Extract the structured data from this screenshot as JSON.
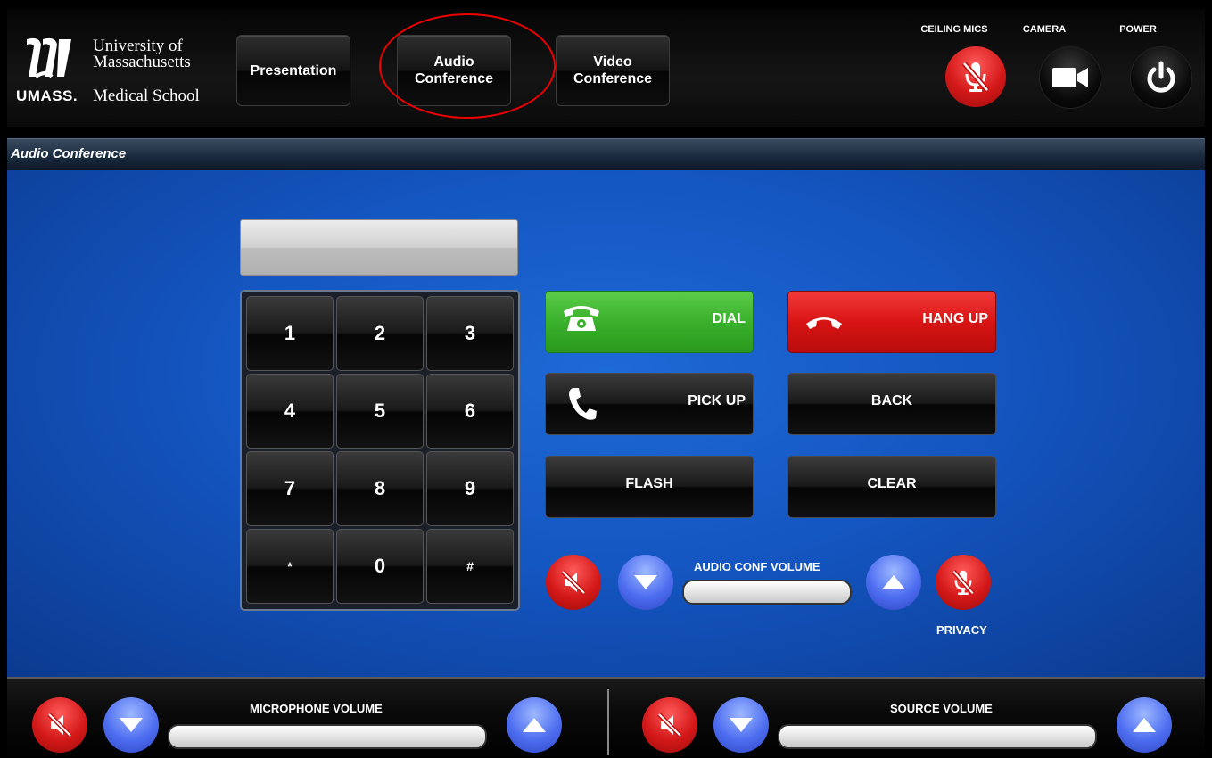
{
  "logo": {
    "umass": "UMASS.",
    "line1": "University of",
    "line2": "Massachusetts",
    "line3": "Medical School"
  },
  "tabs": [
    {
      "label": "Presentation"
    },
    {
      "label": "Audio\nConference"
    },
    {
      "label": "Video\nConference"
    }
  ],
  "header_controls": {
    "ceiling_mics": "CEILING MICS",
    "camera": "CAMERA",
    "power": "POWER"
  },
  "page_title": "Audio Conference",
  "dial_display": {
    "value": ""
  },
  "keypad": [
    "1",
    "2",
    "3",
    "4",
    "5",
    "6",
    "7",
    "8",
    "9",
    "*",
    "0",
    "#"
  ],
  "actions": {
    "dial": "DIAL",
    "hang_up": "HANG UP",
    "pick_up": "PICK UP",
    "back": "BACK",
    "flash": "FLASH",
    "clear": "CLEAR"
  },
  "audio_conf": {
    "volume_label": "AUDIO CONF VOLUME",
    "privacy_label": "PRIVACY"
  },
  "footer": {
    "mic_volume_label": "MICROPHONE VOLUME",
    "source_volume_label": "SOURCE VOLUME"
  },
  "colors": {
    "main_blue": "#1456c2",
    "dial_green": "#3ab02c",
    "hangup_red": "#d81414",
    "mute_red": "#d41818",
    "arrow_blue": "#4d6df0",
    "annotation_red": "#e00000"
  },
  "icons": {
    "ceiling_mics": "mic-muted-icon",
    "camera": "video-camera-icon",
    "power": "power-icon",
    "dial": "telephone-icon",
    "hang_up": "hang-up-icon",
    "pick_up": "handset-icon",
    "mute": "speaker-muted-icon",
    "down": "triangle-down-icon",
    "up": "triangle-up-icon",
    "privacy": "mic-muted-icon"
  }
}
